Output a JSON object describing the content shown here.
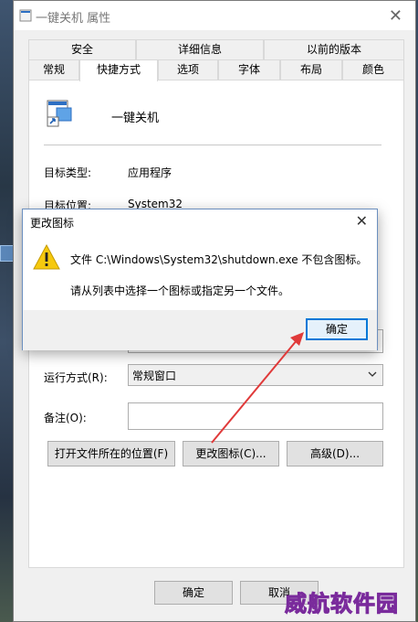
{
  "window": {
    "title": "一键关机 属性",
    "close_glyph": "✕"
  },
  "tabs": {
    "row1": [
      "安全",
      "详细信息",
      "以前的版本"
    ],
    "row2": [
      "常规",
      "快捷方式",
      "选项",
      "字体",
      "布局",
      "颜色"
    ],
    "active": "快捷方式"
  },
  "shortcut": {
    "name": "一键关机",
    "target_type_label": "目标类型:",
    "target_type_value": "应用程序",
    "target_location_label": "目标位置:",
    "target_location_value": "System32",
    "run_label": "运行方式(R):",
    "run_value": "常规窗口",
    "comment_label": "备注(O):",
    "comment_value": ""
  },
  "buttons": {
    "open_location": "打开文件所在的位置(F)",
    "change_icon": "更改图标(C)...",
    "advanced": "高级(D)...",
    "ok": "确定",
    "cancel": "取消"
  },
  "dialog": {
    "title": "更改图标",
    "close_glyph": "✕",
    "message1": "文件 C:\\Windows\\System32\\shutdown.exe 不包含图标。",
    "message2": "请从列表中选择一个图标或指定另一个文件。",
    "ok": "确定"
  },
  "watermark": "威航软件园",
  "icons": [
    "app-title-icon",
    "shortcut-icon",
    "warning-icon",
    "dropdown-chevron-icon",
    "close-icon"
  ],
  "colors": {
    "accent": "#0078d7",
    "arrow": "#e03a3a",
    "warning": "#f6c90e"
  }
}
